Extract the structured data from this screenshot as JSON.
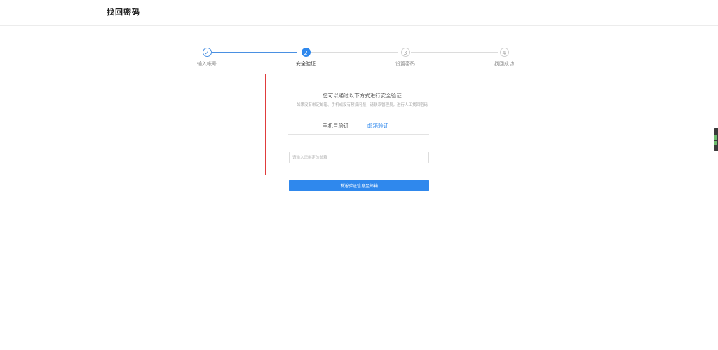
{
  "header": {
    "title": "找回密码"
  },
  "steps": [
    {
      "index": "✓",
      "label": "输入帐号",
      "state": "done"
    },
    {
      "index": "2",
      "label": "安全验证",
      "state": "active"
    },
    {
      "index": "3",
      "label": "设置密码",
      "state": "todo"
    },
    {
      "index": "4",
      "label": "找回成功",
      "state": "todo"
    }
  ],
  "verify": {
    "prompt": "您可以通过以下方式进行安全验证",
    "hint": "如果没有绑定邮箱、手机或没有预设问题，请联系管理员，进行人工找回密码",
    "tabs": {
      "phone": "手机号验证",
      "email": "邮箱验证"
    },
    "selected_tab": "邮箱验证",
    "email_placeholder": "请输入您绑定的邮箱",
    "email_value": "",
    "send_button": "发送验证信息至邮箱"
  },
  "colors": {
    "accent": "#2f88ed",
    "highlight_border": "#e03c3c",
    "done_line": "#4a90e2",
    "todo_line": "#dcdcdc"
  }
}
